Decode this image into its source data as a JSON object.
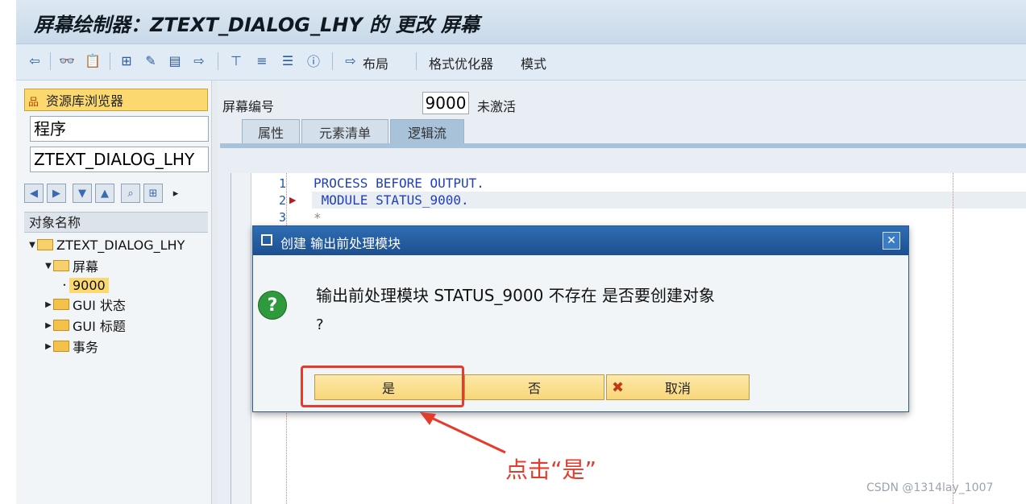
{
  "window": {
    "title": "屏幕绘制器：ZTEXT_DIALOG_LHY 的 更改 屏幕"
  },
  "toolbar": {
    "items": [
      "back-icon",
      "glasses-icon",
      "clipboard-icon",
      "hierarchy-icon",
      "magic-wand-icon",
      "monitor-icon",
      "transport-icon",
      "org-chart-icon",
      "align-icon",
      "list-icon",
      "info-icon"
    ],
    "layout_label": "布局",
    "format_optimizer_label": "格式优化器",
    "mode_label": "模式"
  },
  "left_panel": {
    "repo_browser_label": "资源库浏览器",
    "object_type": "程序",
    "object_name": "ZTEXT_DIALOG_LHY",
    "object_name_header": "对象名称",
    "tree": [
      {
        "label": "ZTEXT_DIALOG_LHY",
        "level": 0,
        "expanded": true
      },
      {
        "label": "屏幕",
        "level": 1,
        "expanded": true
      },
      {
        "label": "9000",
        "level": 2,
        "selected": true
      },
      {
        "label": "GUI 状态",
        "level": 1,
        "expanded": false
      },
      {
        "label": "GUI 标题",
        "level": 1,
        "expanded": false
      },
      {
        "label": "事务",
        "level": 1,
        "expanded": false
      }
    ]
  },
  "screen": {
    "number_label": "屏幕编号",
    "number": "9000",
    "status": "未激活",
    "tabs": [
      "属性",
      "元素清单",
      "逻辑流"
    ],
    "active_tab": "逻辑流"
  },
  "editor": {
    "lines": [
      {
        "no": "1",
        "text": "PROCESS BEFORE OUTPUT."
      },
      {
        "no": "2",
        "text": " MODULE STATUS_9000."
      },
      {
        "no": "3",
        "text": "*"
      }
    ]
  },
  "dialog": {
    "title": "创建 输出前处理模块",
    "message": "输出前处理模块 STATUS_9000 不存在 是否要创建对象",
    "message_line2": "?",
    "yes_label": "是",
    "no_label": "否",
    "cancel_label": "取消"
  },
  "annotation": {
    "text": "点击“是”"
  },
  "watermark": "CSDN @1314lay_1007"
}
